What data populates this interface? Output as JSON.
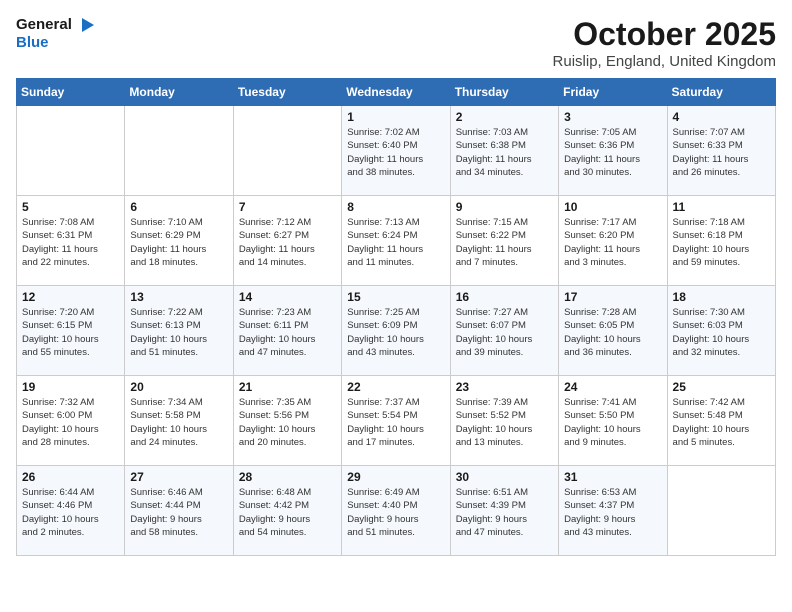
{
  "logo": {
    "line1": "General",
    "line2": "Blue"
  },
  "title": "October 2025",
  "location": "Ruislip, England, United Kingdom",
  "days_of_week": [
    "Sunday",
    "Monday",
    "Tuesday",
    "Wednesday",
    "Thursday",
    "Friday",
    "Saturday"
  ],
  "weeks": [
    [
      {
        "day": "",
        "info": ""
      },
      {
        "day": "",
        "info": ""
      },
      {
        "day": "",
        "info": ""
      },
      {
        "day": "1",
        "info": "Sunrise: 7:02 AM\nSunset: 6:40 PM\nDaylight: 11 hours\nand 38 minutes."
      },
      {
        "day": "2",
        "info": "Sunrise: 7:03 AM\nSunset: 6:38 PM\nDaylight: 11 hours\nand 34 minutes."
      },
      {
        "day": "3",
        "info": "Sunrise: 7:05 AM\nSunset: 6:36 PM\nDaylight: 11 hours\nand 30 minutes."
      },
      {
        "day": "4",
        "info": "Sunrise: 7:07 AM\nSunset: 6:33 PM\nDaylight: 11 hours\nand 26 minutes."
      }
    ],
    [
      {
        "day": "5",
        "info": "Sunrise: 7:08 AM\nSunset: 6:31 PM\nDaylight: 11 hours\nand 22 minutes."
      },
      {
        "day": "6",
        "info": "Sunrise: 7:10 AM\nSunset: 6:29 PM\nDaylight: 11 hours\nand 18 minutes."
      },
      {
        "day": "7",
        "info": "Sunrise: 7:12 AM\nSunset: 6:27 PM\nDaylight: 11 hours\nand 14 minutes."
      },
      {
        "day": "8",
        "info": "Sunrise: 7:13 AM\nSunset: 6:24 PM\nDaylight: 11 hours\nand 11 minutes."
      },
      {
        "day": "9",
        "info": "Sunrise: 7:15 AM\nSunset: 6:22 PM\nDaylight: 11 hours\nand 7 minutes."
      },
      {
        "day": "10",
        "info": "Sunrise: 7:17 AM\nSunset: 6:20 PM\nDaylight: 11 hours\nand 3 minutes."
      },
      {
        "day": "11",
        "info": "Sunrise: 7:18 AM\nSunset: 6:18 PM\nDaylight: 10 hours\nand 59 minutes."
      }
    ],
    [
      {
        "day": "12",
        "info": "Sunrise: 7:20 AM\nSunset: 6:15 PM\nDaylight: 10 hours\nand 55 minutes."
      },
      {
        "day": "13",
        "info": "Sunrise: 7:22 AM\nSunset: 6:13 PM\nDaylight: 10 hours\nand 51 minutes."
      },
      {
        "day": "14",
        "info": "Sunrise: 7:23 AM\nSunset: 6:11 PM\nDaylight: 10 hours\nand 47 minutes."
      },
      {
        "day": "15",
        "info": "Sunrise: 7:25 AM\nSunset: 6:09 PM\nDaylight: 10 hours\nand 43 minutes."
      },
      {
        "day": "16",
        "info": "Sunrise: 7:27 AM\nSunset: 6:07 PM\nDaylight: 10 hours\nand 39 minutes."
      },
      {
        "day": "17",
        "info": "Sunrise: 7:28 AM\nSunset: 6:05 PM\nDaylight: 10 hours\nand 36 minutes."
      },
      {
        "day": "18",
        "info": "Sunrise: 7:30 AM\nSunset: 6:03 PM\nDaylight: 10 hours\nand 32 minutes."
      }
    ],
    [
      {
        "day": "19",
        "info": "Sunrise: 7:32 AM\nSunset: 6:00 PM\nDaylight: 10 hours\nand 28 minutes."
      },
      {
        "day": "20",
        "info": "Sunrise: 7:34 AM\nSunset: 5:58 PM\nDaylight: 10 hours\nand 24 minutes."
      },
      {
        "day": "21",
        "info": "Sunrise: 7:35 AM\nSunset: 5:56 PM\nDaylight: 10 hours\nand 20 minutes."
      },
      {
        "day": "22",
        "info": "Sunrise: 7:37 AM\nSunset: 5:54 PM\nDaylight: 10 hours\nand 17 minutes."
      },
      {
        "day": "23",
        "info": "Sunrise: 7:39 AM\nSunset: 5:52 PM\nDaylight: 10 hours\nand 13 minutes."
      },
      {
        "day": "24",
        "info": "Sunrise: 7:41 AM\nSunset: 5:50 PM\nDaylight: 10 hours\nand 9 minutes."
      },
      {
        "day": "25",
        "info": "Sunrise: 7:42 AM\nSunset: 5:48 PM\nDaylight: 10 hours\nand 5 minutes."
      }
    ],
    [
      {
        "day": "26",
        "info": "Sunrise: 6:44 AM\nSunset: 4:46 PM\nDaylight: 10 hours\nand 2 minutes."
      },
      {
        "day": "27",
        "info": "Sunrise: 6:46 AM\nSunset: 4:44 PM\nDaylight: 9 hours\nand 58 minutes."
      },
      {
        "day": "28",
        "info": "Sunrise: 6:48 AM\nSunset: 4:42 PM\nDaylight: 9 hours\nand 54 minutes."
      },
      {
        "day": "29",
        "info": "Sunrise: 6:49 AM\nSunset: 4:40 PM\nDaylight: 9 hours\nand 51 minutes."
      },
      {
        "day": "30",
        "info": "Sunrise: 6:51 AM\nSunset: 4:39 PM\nDaylight: 9 hours\nand 47 minutes."
      },
      {
        "day": "31",
        "info": "Sunrise: 6:53 AM\nSunset: 4:37 PM\nDaylight: 9 hours\nand 43 minutes."
      },
      {
        "day": "",
        "info": ""
      }
    ]
  ]
}
